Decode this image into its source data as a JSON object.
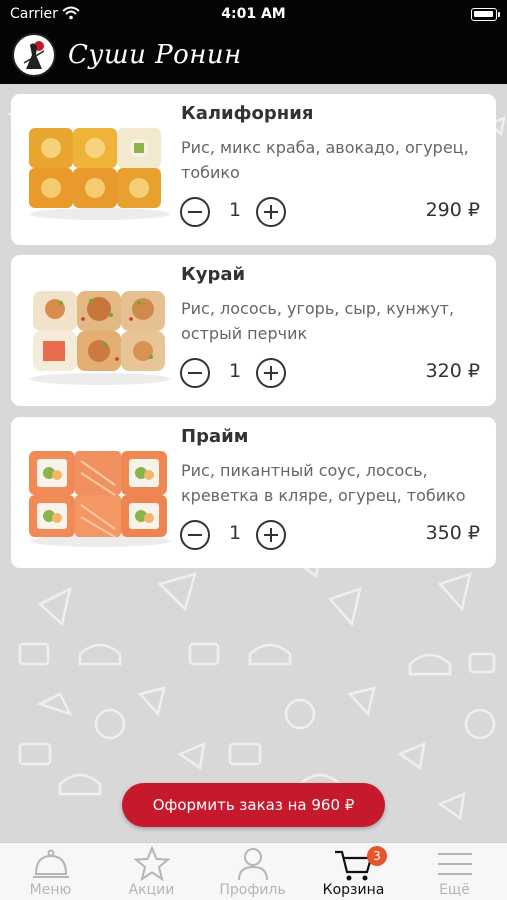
{
  "status_bar": {
    "carrier": "Carrier",
    "time": "4:01 AM"
  },
  "header": {
    "brand_name": "Суши Ронин"
  },
  "products": [
    {
      "name": "Калифорния",
      "description": "Рис, микс краба, авокадо, огурец, тобико",
      "quantity": "1",
      "price": "290 ₽"
    },
    {
      "name": "Курай",
      "description": "Рис, лосось, угорь, сыр, кунжут, острый перчик",
      "quantity": "1",
      "price": "320 ₽"
    },
    {
      "name": "Прайм",
      "description": "Рис, пикантный соус, лосось, креветка в кляре, огурец, тобико",
      "quantity": "1",
      "price": "350 ₽"
    }
  ],
  "order_button": {
    "label": "Оформить заказ на 960 ₽"
  },
  "tabs": [
    {
      "label": "Меню",
      "icon": "cloche-icon"
    },
    {
      "label": "Акции",
      "icon": "star-icon"
    },
    {
      "label": "Профиль",
      "icon": "person-icon"
    },
    {
      "label": "Корзина",
      "icon": "cart-icon",
      "badge": "3",
      "active": true
    },
    {
      "label": "Ещё",
      "icon": "menu-icon"
    }
  ],
  "colors": {
    "accent": "#c6192c",
    "badge": "#e8542c",
    "header": "#050505"
  }
}
